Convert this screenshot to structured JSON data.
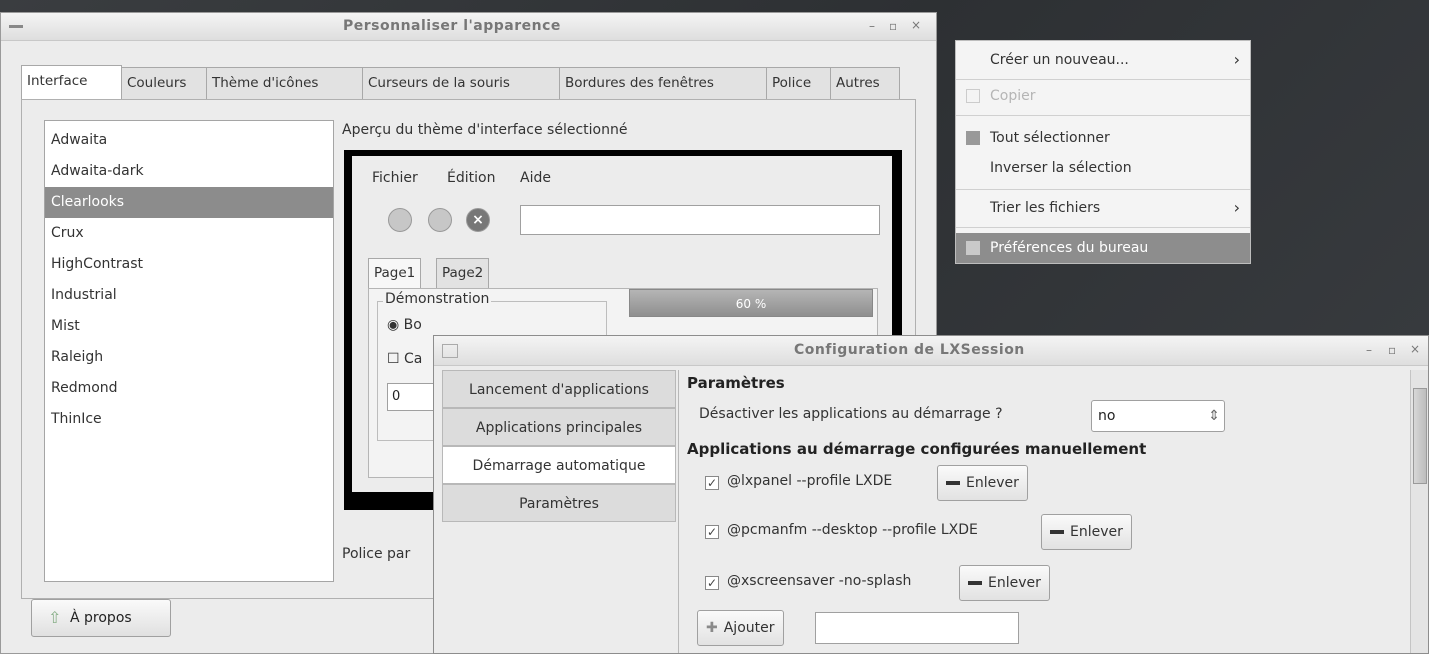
{
  "win1": {
    "title": "Personnaliser l'apparence",
    "controls": {
      "min": "–",
      "max": "▫",
      "close": "×"
    },
    "tabs": [
      "Interface",
      "Couleurs",
      "Thème d'icônes",
      "Curseurs de la souris",
      "Bordures des fenêtres",
      "Police",
      "Autres"
    ],
    "themes": [
      "Adwaita",
      "Adwaita-dark",
      "Clearlooks",
      "Crux",
      "HighContrast",
      "Industrial",
      "Mist",
      "Raleigh",
      "Redmond",
      "ThinIce"
    ],
    "selected_theme": "Clearlooks",
    "preview_label": "Aperçu du thème d'interface sélectionné",
    "preview": {
      "menu": [
        "Fichier",
        "Édition",
        "Aide"
      ],
      "tabs": [
        "Page1",
        "Page2"
      ],
      "frame_label": "Démonstration",
      "radio": "Bo",
      "check": "Ca",
      "spin_value": "0",
      "progress": "60 %"
    },
    "font_label": "Police par",
    "about_button": "À propos"
  },
  "context_menu": {
    "items": [
      {
        "label": "Créer un nouveau...",
        "arrow": "›",
        "state": "normal"
      },
      {
        "label": "Copier",
        "state": "disabled"
      },
      {
        "label": "Tout sélectionner",
        "state": "normal"
      },
      {
        "label": "Inverser la sélection",
        "state": "normal"
      },
      {
        "label": "Trier les fichiers",
        "arrow": "›",
        "state": "normal"
      },
      {
        "label": "Préférences du bureau",
        "state": "selected"
      }
    ]
  },
  "win2": {
    "title": "Configuration de LXSession",
    "controls": {
      "min": "–",
      "max": "▫",
      "close": "×"
    },
    "sidetabs": [
      "Lancement d'applications",
      "Applications principales",
      "Démarrage automatique",
      "Paramètres"
    ],
    "active_sidetab": "Démarrage automatique",
    "section_params": "Paramètres",
    "disable_label": "Désactiver les applications au démarrage ?",
    "disable_value": "no",
    "section_autostart": "Applications au démarrage configurées manuellement",
    "autostart": [
      {
        "command": "@lxpanel --profile LXDE",
        "checked": true
      },
      {
        "command": "@pcmanfm --desktop --profile LXDE",
        "checked": true
      },
      {
        "command": "@xscreensaver -no-splash",
        "checked": true
      }
    ],
    "remove_button": "Enlever",
    "add_button": "Ajouter",
    "add_input_value": ""
  }
}
